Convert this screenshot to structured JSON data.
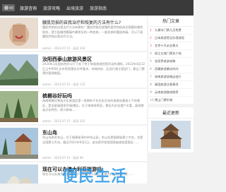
{
  "nav": {
    "items": [
      "旅游咨询",
      "旅游攻略",
      "出境旅游",
      "旅游指南"
    ]
  },
  "articles": [
    {
      "title": "腰肌劳损的自我治疗和恢复的方法有什么?",
      "excerpt": "腰肌劳损的自我治疗方法有哪些？腰肌劳损也就慢性疲劳和肌肉及筋膜的慢性损伤，是引起慢性腰痛中最常见的一种疾病，一般发病时腰部疼痛，可以下面腰肌劳损自我治疗方法。",
      "meta": "admin · 2023-07-15 · 阅读 166"
    },
    {
      "title": "汝阳西泰山旅游风景区",
      "excerpt": "2020年3月国务院办公厅下发了关于恢复旅游经营活动的通知，2022年4月12日上午95时,全市贯彻落实文件要求，市政府办、区县行政主管部门，建立门票预约管理制度。",
      "meta": "admin · 2023-07-15 · 阅读 135"
    },
    {
      "title": "槟榔谷好玩吗",
      "excerpt": "海南槟榔谷黎苗文化旅游区是一家拥有千年历史文化的海南岛最具人气的景区，是五星级国家5A级景区，位于海南保亭县，景区内文化遗产丰富，展现黎苗文化特色，原汁原味……",
      "meta": "admin · 2023-07-15 · 阅读 102"
    },
    {
      "title": "东山岛",
      "excerpt": "东山岛原名东山，位于福建省漳州市东山县，东山岛是福建省第二大岛，也是全国第七大岛，截至2022年9月1日，该岛获评首批国家级旅游度假区……",
      "meta": "admin · 2023-07-15 · 阅读 98"
    },
    {
      "title": "现在可以去澳大利亚旅游吗",
      "excerpt": "现在可以去澳大利亚旅游吗？2022年7月6日，澳大利亚取消入境……",
      "meta": ""
    }
  ],
  "sidebar": {
    "hot_title": "热门文章",
    "hot_items": [
      {
        "num": "1",
        "text": "九寨沟门票几月免费"
      },
      {
        "num": "2",
        "text": "日本旅游签证办理流程"
      },
      {
        "num": "3",
        "text": "北京十大必去景点"
      },
      {
        "num": "4",
        "text": "丽江古城门票多少钱"
      },
      {
        "num": "5",
        "text": "张家界旅游攻略"
      },
      {
        "num": "6",
        "text": "西藏旅游最佳时间"
      },
      {
        "num": "7",
        "text": "海南旅游攻略自由行"
      },
      {
        "num": "8",
        "text": "泰国旅游注意事项"
      },
      {
        "num": "9",
        "text": "云南旅游路线推荐"
      },
      {
        "num": "10",
        "text": "黄山门票价格"
      }
    ],
    "latest_title": "最近更新"
  },
  "watermark": "便民生活",
  "colors": {
    "topbar": "#3a3a3a",
    "accent": "#e36a5a",
    "watermark": "#2896e6"
  }
}
